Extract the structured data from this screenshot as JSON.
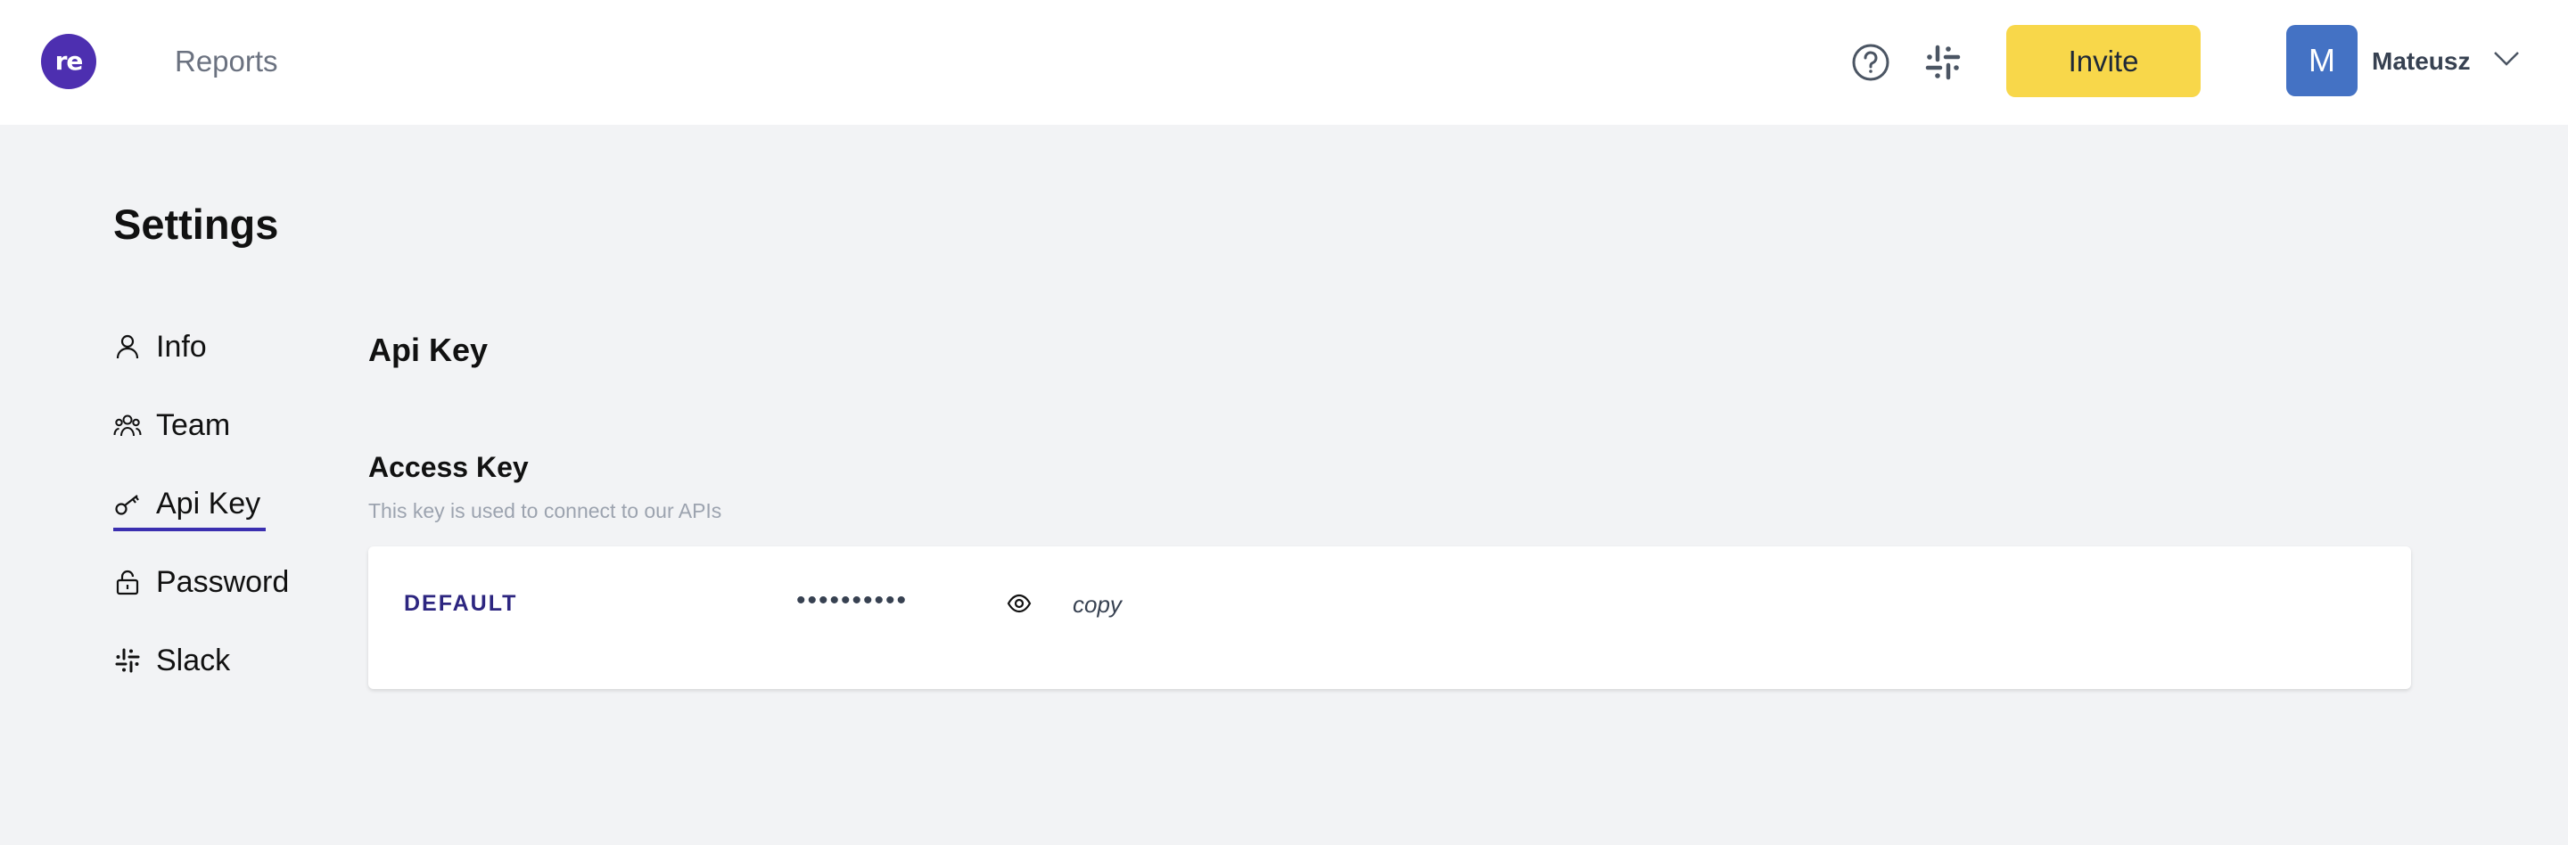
{
  "header": {
    "logo_text": "re",
    "nav_reports": "Reports",
    "help_icon": "question-circle-icon",
    "slack_icon": "slack-icon",
    "invite_label": "Invite",
    "avatar_initial": "M",
    "user_name": "Mateusz",
    "dropdown_icon": "chevron-down-icon"
  },
  "page": {
    "title": "Settings"
  },
  "sidebar": {
    "items": [
      {
        "label": "Info",
        "icon": "user-icon"
      },
      {
        "label": "Team",
        "icon": "team-icon"
      },
      {
        "label": "Api Key",
        "icon": "key-icon",
        "active": true
      },
      {
        "label": "Password",
        "icon": "lock-icon"
      },
      {
        "label": "Slack",
        "icon": "slack-icon"
      }
    ]
  },
  "main": {
    "section_title": "Api Key",
    "access_key_title": "Access Key",
    "access_key_desc": "This key is used to connect to our APIs",
    "keys": [
      {
        "name": "DEFAULT",
        "masked_value": "••••••••••",
        "reveal_icon": "eye-icon",
        "copy_label": "copy"
      }
    ]
  },
  "colors": {
    "brand": "#4d2fb0",
    "invite_bg": "#f8d74a",
    "avatar_bg": "#4472c4",
    "active_underline": "#3b2fb0",
    "page_bg": "#f2f3f5"
  }
}
